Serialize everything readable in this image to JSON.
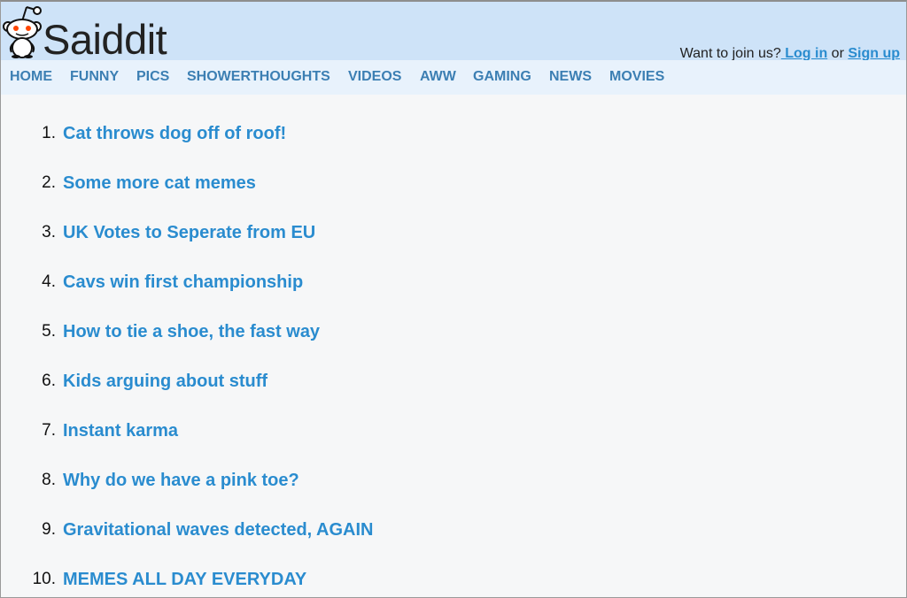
{
  "header": {
    "site_name": "Saiddit",
    "join_prompt": "Want to join us?",
    "login_label": " Log in",
    "or_text": " or ",
    "signup_label": "Sign up"
  },
  "nav": {
    "items": [
      "HOME",
      "FUNNY",
      "PICS",
      "SHOWERTHOUGHTS",
      "VIDEOS",
      "AWW",
      "GAMING",
      "NEWS",
      "MOVIES"
    ]
  },
  "posts": [
    {
      "rank": "1.",
      "title": "Cat throws dog off of roof!"
    },
    {
      "rank": "2.",
      "title": "Some more cat memes"
    },
    {
      "rank": "3.",
      "title": "UK Votes to Seperate from EU"
    },
    {
      "rank": "4.",
      "title": "Cavs win first championship"
    },
    {
      "rank": "5.",
      "title": "How to tie a shoe, the fast way"
    },
    {
      "rank": "6.",
      "title": "Kids arguing about stuff"
    },
    {
      "rank": "7.",
      "title": "Instant karma"
    },
    {
      "rank": "8.",
      "title": "Why do we have a pink toe?"
    },
    {
      "rank": "9.",
      "title": "Gravitational waves detected, AGAIN"
    },
    {
      "rank": "10.",
      "title": "MEMES ALL DAY EVERYDAY"
    }
  ],
  "colors": {
    "header_bg": "#cee3f8",
    "nav_bg": "#e8f2fc",
    "link": "#2a8ccf",
    "nav_link": "#3c7fb3",
    "logo_eyes": "#ff4500"
  },
  "icons": {
    "logo": "alien-mascot-icon"
  }
}
